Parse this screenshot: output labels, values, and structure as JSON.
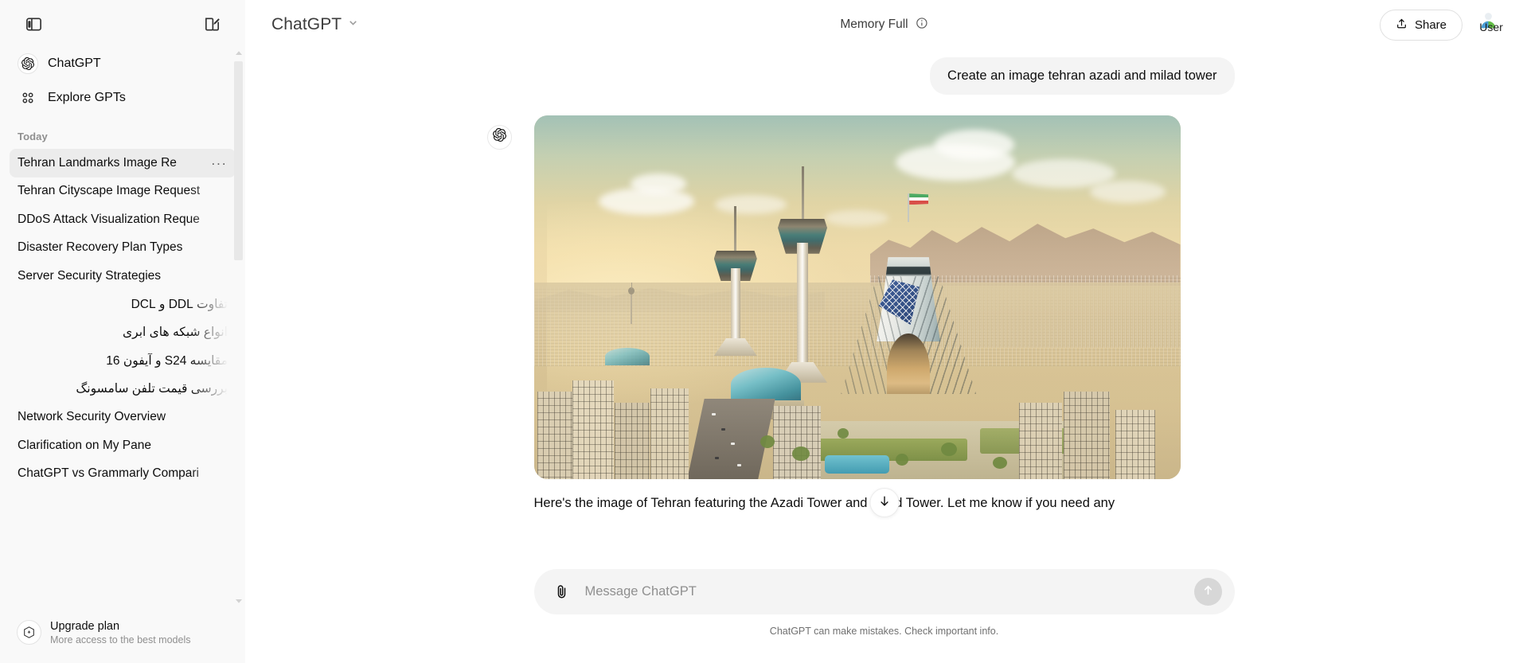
{
  "sidebar": {
    "toggle_icon": "sidebar-toggle-icon",
    "new_chat_icon": "new-chat-pencil-icon",
    "nav": [
      {
        "label": "ChatGPT",
        "icon": "openai-logo-icon"
      },
      {
        "label": "Explore GPTs",
        "icon": "grid-squares-icon"
      }
    ],
    "section_title": "Today",
    "chats": [
      {
        "title": "Tehran Landmarks Image Re",
        "active": true,
        "rtl": false
      },
      {
        "title": "Tehran Cityscape Image Request",
        "active": false,
        "rtl": false
      },
      {
        "title": "DDoS Attack Visualization Reque",
        "active": false,
        "rtl": false
      },
      {
        "title": "Disaster Recovery Plan Types",
        "active": false,
        "rtl": false
      },
      {
        "title": "Server Security Strategies",
        "active": false,
        "rtl": false
      },
      {
        "title": "تفاوت DDL و DCL",
        "active": false,
        "rtl": true
      },
      {
        "title": "انواع شبکه های ابری",
        "active": false,
        "rtl": true
      },
      {
        "title": "مقایسه S24 و آیفون 16",
        "active": false,
        "rtl": true
      },
      {
        "title": "بررسی قیمت تلفن سامسونگ",
        "active": false,
        "rtl": true
      },
      {
        "title": "Network Security Overview",
        "active": false,
        "rtl": false
      },
      {
        "title": "Clarification on My Pane",
        "active": false,
        "rtl": false
      },
      {
        "title": "ChatGPT vs Grammarly Compari",
        "active": false,
        "rtl": false
      }
    ],
    "chat_menu_dots": "···",
    "upgrade": {
      "title": "Upgrade plan",
      "subtitle": "More access to the best models",
      "icon": "sparkle-hexagon-icon"
    }
  },
  "topbar": {
    "model_name": "ChatGPT",
    "model_chevron_icon": "chevron-down-icon",
    "memory_label": "Memory Full",
    "memory_info_icon": "info-circle-icon",
    "share_label": "Share",
    "share_icon": "upload-share-icon",
    "avatar_label": "User",
    "avatar_icon": "user-avatar-icon"
  },
  "conversation": {
    "user_message": "Create an image tehran azadi and milad tower",
    "assistant_avatar_icon": "openai-logo-icon",
    "assistant_text": "Here's the image of Tehran featuring the Azadi Tower and Milad Tower. Let me know if you need any",
    "assistant_image_alt": "Generated cityscape of Tehran with Azadi Tower and Milad Tower at golden hour",
    "scroll_down_icon": "arrow-down-icon"
  },
  "composer": {
    "attach_icon": "paperclip-icon",
    "placeholder": "Message ChatGPT",
    "value": "",
    "send_icon": "arrow-up-send-icon"
  },
  "footer": {
    "disclaimer": "ChatGPT can make mistakes. Check important info.",
    "help_label": "?"
  },
  "colors": {
    "sidebar_bg": "#f9f9f9",
    "bubble_bg": "#f4f4f4",
    "text_primary": "#0d0d0d",
    "text_muted": "#8f8f8f",
    "hover": "#ececec"
  }
}
